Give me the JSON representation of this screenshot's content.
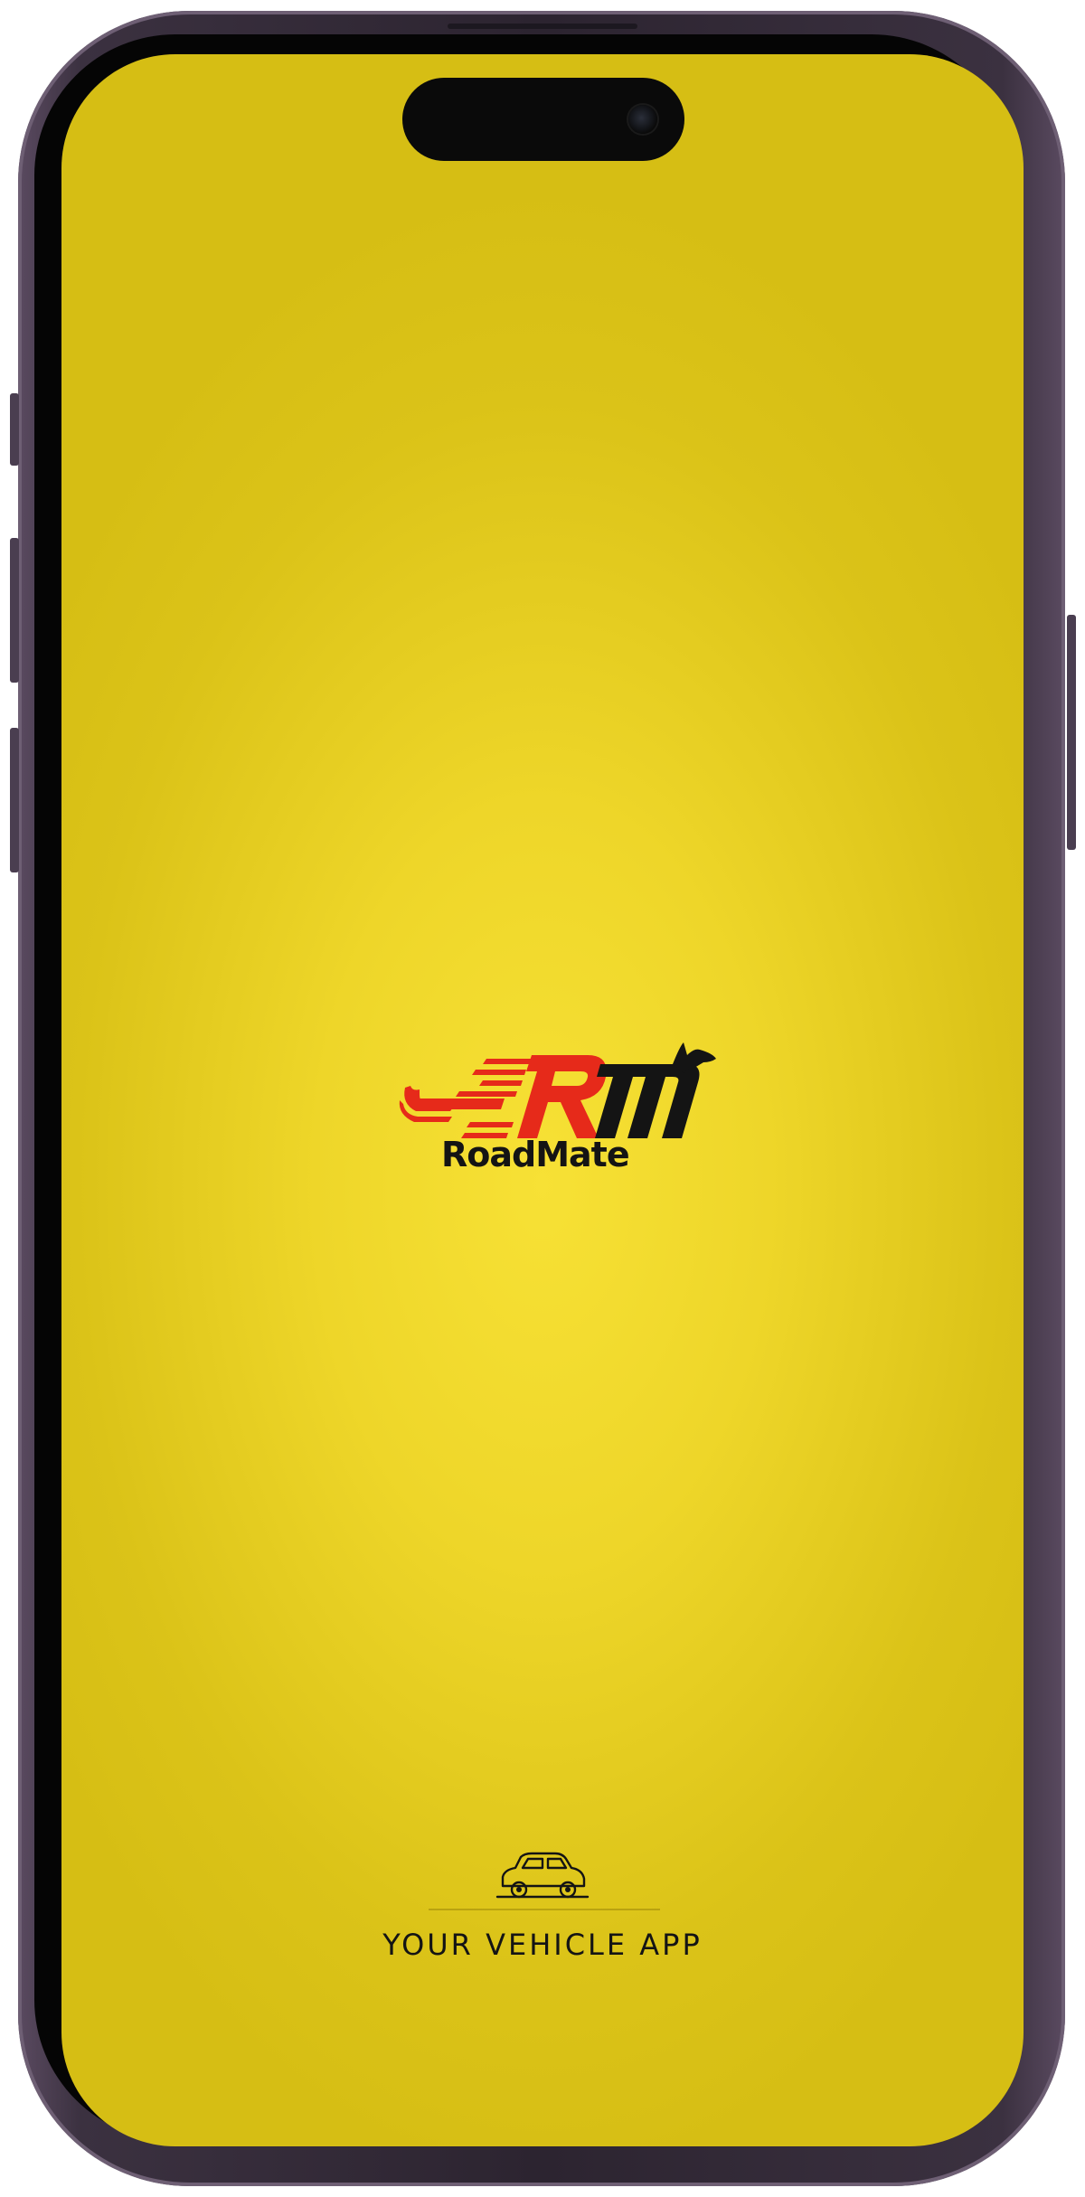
{
  "app": {
    "brand_name": "RoadMate",
    "tagline": "YOUR VEHICLE APP"
  },
  "colors": {
    "background": "#f2da2c",
    "accent_red": "#e62a1a",
    "logo_dark": "#141414"
  },
  "icons": {
    "logo": "roadmate-wrench-logo",
    "car": "car-outline-icon",
    "camera": "front-camera"
  }
}
